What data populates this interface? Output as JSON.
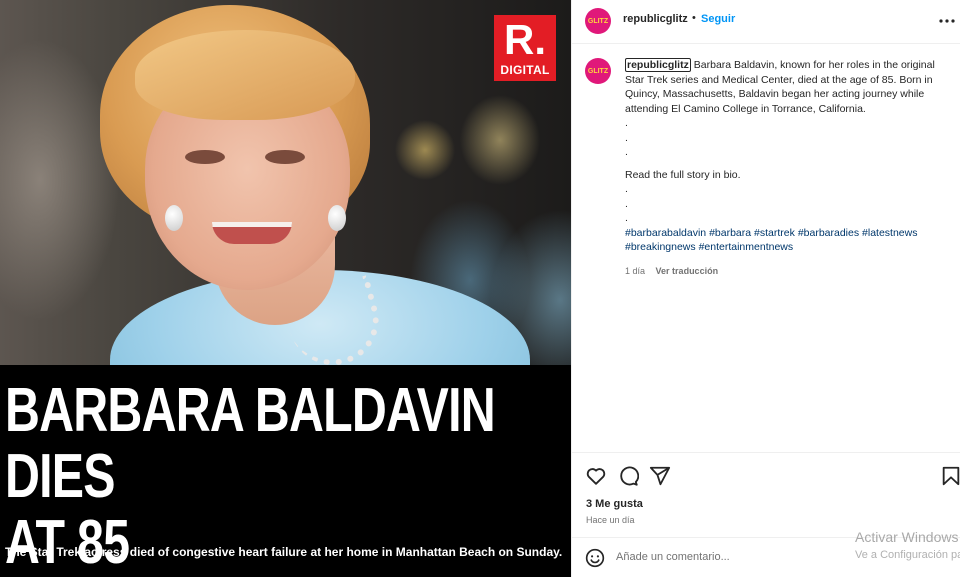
{
  "media": {
    "brand_logo": {
      "mark": "R.",
      "label": "DIGITAL",
      "color": "#e31d25"
    },
    "headline_lines": [
      "BARBARA BALDAVIN DIES",
      "AT 85"
    ],
    "subheadline": "The Star Trek actress died of congestive heart failure at her home in Manhattan Beach on Sunday."
  },
  "header": {
    "avatar_text": "GLITZ",
    "username": "republicglitz",
    "separator": "•",
    "follow_label": "Seguir",
    "more_icon": "more-horizontal-icon"
  },
  "caption": {
    "avatar_text": "GLITZ",
    "username": "republicglitz",
    "text": "Barbara Baldavin, known for her roles in the original Star Trek series and Medical Center, died at the age of 85. Born in Quincy, Massachusetts, Baldavin began her acting journey while attending El Camino College in Torrance, California.",
    "dots_1": [
      ".",
      ".",
      "."
    ],
    "read_more": "Read the full story in bio.",
    "dots_2": [
      ".",
      ".",
      "."
    ],
    "hashtags": [
      "#barbarabaldavin",
      "#barbara",
      "#startrek",
      "#barbaradies",
      "#latestnews",
      "#breakingnews",
      "#entertainmentnews"
    ],
    "time": "1 día",
    "see_translation": "Ver traducción"
  },
  "actions": {
    "icons": [
      "heart-icon",
      "comment-icon",
      "share-icon",
      "bookmark-icon"
    ],
    "likes": "3 Me gusta",
    "posted": "Hace un día"
  },
  "comment": {
    "placeholder": "Añade un comentario...",
    "emoji_icon": "emoji-icon"
  },
  "watermark": {
    "title": "Activar Windows",
    "subtitle": "Ve a Configuración para activar Windows."
  },
  "colors": {
    "link_blue": "#0095f6",
    "hashtag_blue": "#00376b",
    "avatar_pink": "#e0187a",
    "muted_text": "#737373"
  }
}
